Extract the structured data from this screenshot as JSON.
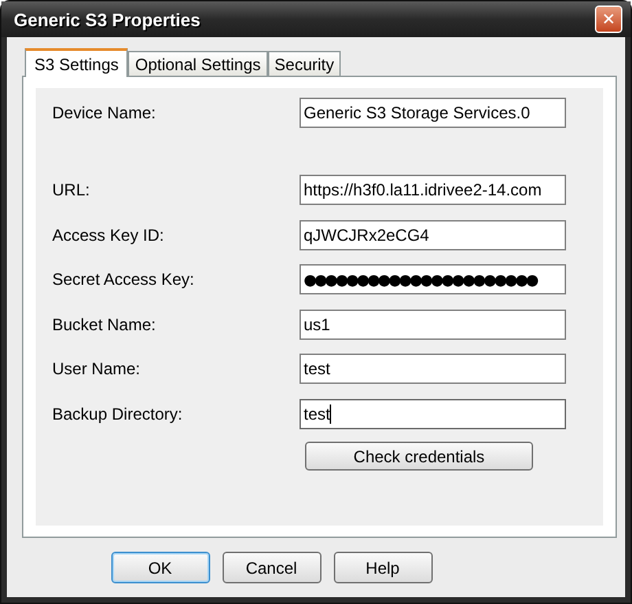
{
  "window": {
    "title": "Generic S3 Properties",
    "close_button": "✕"
  },
  "tabs": [
    {
      "label": "S3 Settings",
      "selected": true
    },
    {
      "label": "Optional Settings",
      "selected": false
    },
    {
      "label": "Security",
      "selected": false
    }
  ],
  "fields": [
    {
      "label": "Device Name:",
      "value": "Generic S3 Storage Services.0",
      "focused": false
    },
    {
      "label": "URL:",
      "value": "https://h3f0.la11.idrivee2-14.com",
      "focused": false
    },
    {
      "label": "Access Key ID:",
      "value": "qJWCJRx2eCG4",
      "focused": false
    },
    {
      "label": "Secret Access Key:",
      "value": "●●●●●●●●●●●●●●●●●●●●●●",
      "focused": false,
      "kind": "password"
    },
    {
      "label": "Bucket Name:",
      "value": "us1",
      "focused": false
    },
    {
      "label": "User Name:",
      "value": "test",
      "focused": false
    },
    {
      "label": "Backup Directory:",
      "value": "test",
      "focused": true
    }
  ],
  "check_button": "Check credentials",
  "buttons": [
    {
      "label": "OK",
      "default": true
    },
    {
      "label": "Cancel",
      "default": false
    },
    {
      "label": "Help",
      "default": false
    }
  ]
}
